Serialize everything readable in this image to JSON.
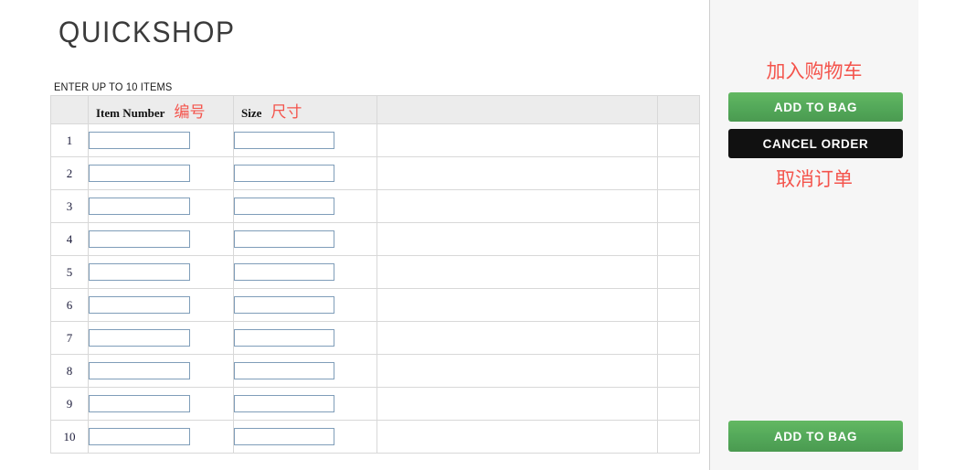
{
  "brand": {
    "name": "QUICKSHOP"
  },
  "main": {
    "instruction": "ENTER UP TO 10 ITEMS",
    "table": {
      "headers": {
        "number": "",
        "item_number_en": "Item Number",
        "item_number_cjk": "编号",
        "size_en": "Size",
        "size_cjk": "尺寸",
        "blank": "",
        "last": ""
      },
      "rows": [
        {
          "number": "1",
          "item_number": "",
          "size": ""
        },
        {
          "number": "2",
          "item_number": "",
          "size": ""
        },
        {
          "number": "3",
          "item_number": "",
          "size": ""
        },
        {
          "number": "4",
          "item_number": "",
          "size": ""
        },
        {
          "number": "5",
          "item_number": "",
          "size": ""
        },
        {
          "number": "6",
          "item_number": "",
          "size": ""
        },
        {
          "number": "7",
          "item_number": "",
          "size": ""
        },
        {
          "number": "8",
          "item_number": "",
          "size": ""
        },
        {
          "number": "9",
          "item_number": "",
          "size": ""
        },
        {
          "number": "10",
          "item_number": "",
          "size": ""
        }
      ]
    }
  },
  "sidebar": {
    "note_add_to_bag": "加入购物车",
    "note_cancel_order": "取消订单",
    "add_to_bag_label": "ADD TO BAG",
    "cancel_order_label": "CANCEL ORDER",
    "add_to_bag_bottom_label": "ADD TO BAG"
  },
  "colors": {
    "accent_green": "#54a95a",
    "cancel_black": "#111111",
    "annotation_red": "#f4544c",
    "sidebar_bg": "#f6f6f6",
    "table_header_bg": "#ececec",
    "input_border": "#7f9db9"
  }
}
